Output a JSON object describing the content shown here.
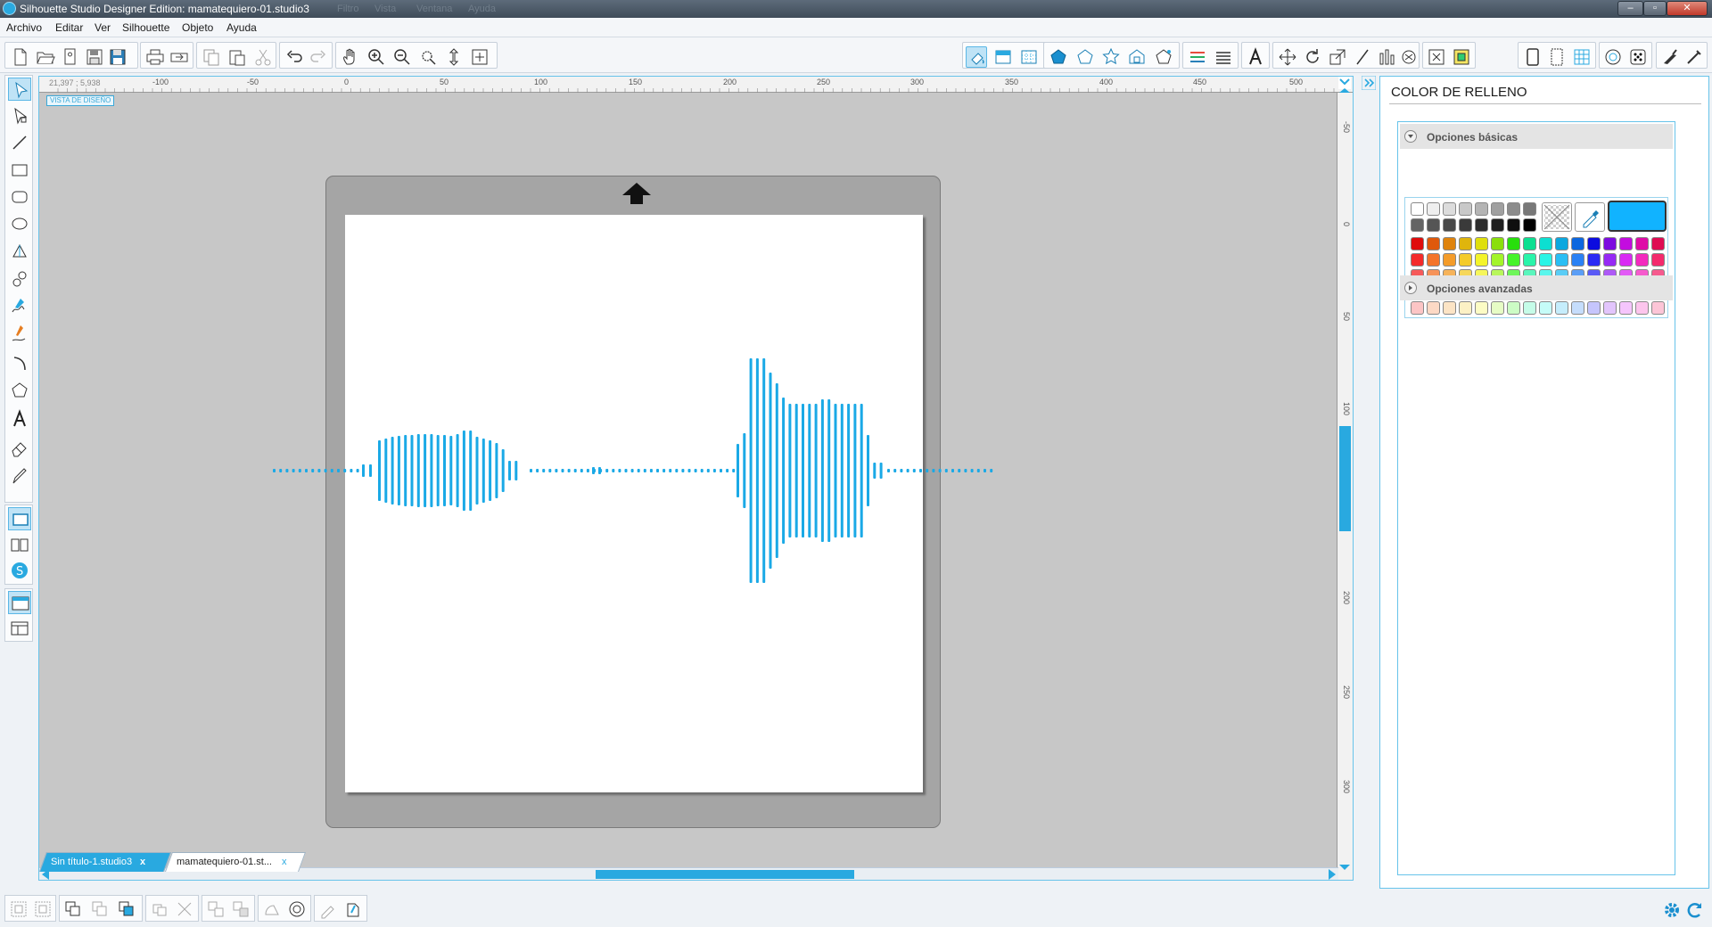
{
  "window": {
    "title": "Silhouette Studio Designer Edition: mamatequiero-01.studio3",
    "ghost_menu": [
      "Filtro",
      "Vista",
      "Ventana",
      "Ayuda"
    ],
    "controls": [
      "minimize",
      "maximize",
      "close"
    ]
  },
  "menu": [
    "Archivo",
    "Editar",
    "Ver",
    "Silhouette",
    "Objeto",
    "Ayuda"
  ],
  "toolbar_left_icons": [
    "new-document-icon",
    "open-folder-icon",
    "library-icon",
    "save-icon",
    "save-library-icon",
    "print-icon",
    "send-to-silhouette-icon",
    "copy-icon",
    "paste-icon",
    "cut-icon",
    "undo-icon",
    "redo-icon",
    "pan-hand-icon",
    "zoom-in-icon",
    "zoom-out-icon",
    "zoom-selection-icon",
    "drag-zoom-icon",
    "fit-to-page-icon"
  ],
  "toolbar_right_icons": [
    "fill-color-icon",
    "fill-gradient-icon",
    "fill-pattern-icon",
    "line-color-icon",
    "line-style-icon",
    "shadow-icon",
    "stroke-icon",
    "sketch-icon",
    "line-width-icon",
    "align-icon",
    "text-style-icon",
    "transform-icon",
    "rotate-icon",
    "scale-icon",
    "shear-icon",
    "replicate-icon",
    "nest-icon",
    "modify-icon",
    "offset-icon",
    "trace-icon",
    "page-setup-icon",
    "cut-settings-icon",
    "grid-icon",
    "registration-icon",
    "point-editing-icon",
    "knife-icon",
    "more-icon"
  ],
  "left_tools": [
    "select-icon",
    "point-edit-icon",
    "line-icon",
    "rectangle-icon",
    "rounded-rectangle-icon",
    "ellipse-icon",
    "polygon-tool-icon",
    "curve-icon",
    "freehand-icon",
    "smooth-freehand-icon",
    "arc-icon",
    "regular-polygon-icon",
    "text-tool-icon",
    "eraser-icon",
    "knife-tool-icon",
    "design-view-icon",
    "library-view-icon",
    "store-icon",
    "single-panel-icon",
    "split-panel-icon"
  ],
  "canvas": {
    "coords": "21,397 ; 5,938",
    "view_label": "VISTA DE DISEÑO",
    "hruler_labels": [
      "-100",
      "-50",
      "0",
      "50",
      "100",
      "150",
      "200",
      "250",
      "300",
      "350",
      "400",
      "450",
      "500"
    ],
    "vruler_labels": [
      "-50",
      "0",
      "50",
      "100",
      "150",
      "200",
      "250",
      "300"
    ]
  },
  "tabs": [
    {
      "label": "Sin título-1.studio3",
      "close": "x"
    },
    {
      "label": "mamatequiero-01.st...",
      "close": "x"
    }
  ],
  "panel": {
    "title": "COLOR DE RELLENO",
    "basic_label": "Opciones básicas",
    "advanced_label": "Opciones avanzadas",
    "current_color": "#11b3ff"
  },
  "colors": {
    "accent": "#29a9e0",
    "wave": "#1aa9e6",
    "mat": "#a5a5a5",
    "workspace": "#c7c7c7"
  },
  "bottom_icons": [
    "group-icon",
    "ungroup-icon",
    "bring-to-front-icon",
    "send-to-back-icon",
    "weld-icon",
    "release-compound-icon",
    "make-compound-icon",
    "duplicate-icon",
    "mirror-icon",
    "crop-icon",
    "offset-shape-icon",
    "trace-edit-icon",
    "send-icon"
  ],
  "status_icons": [
    "settings-gear-icon",
    "sync-icon"
  ]
}
